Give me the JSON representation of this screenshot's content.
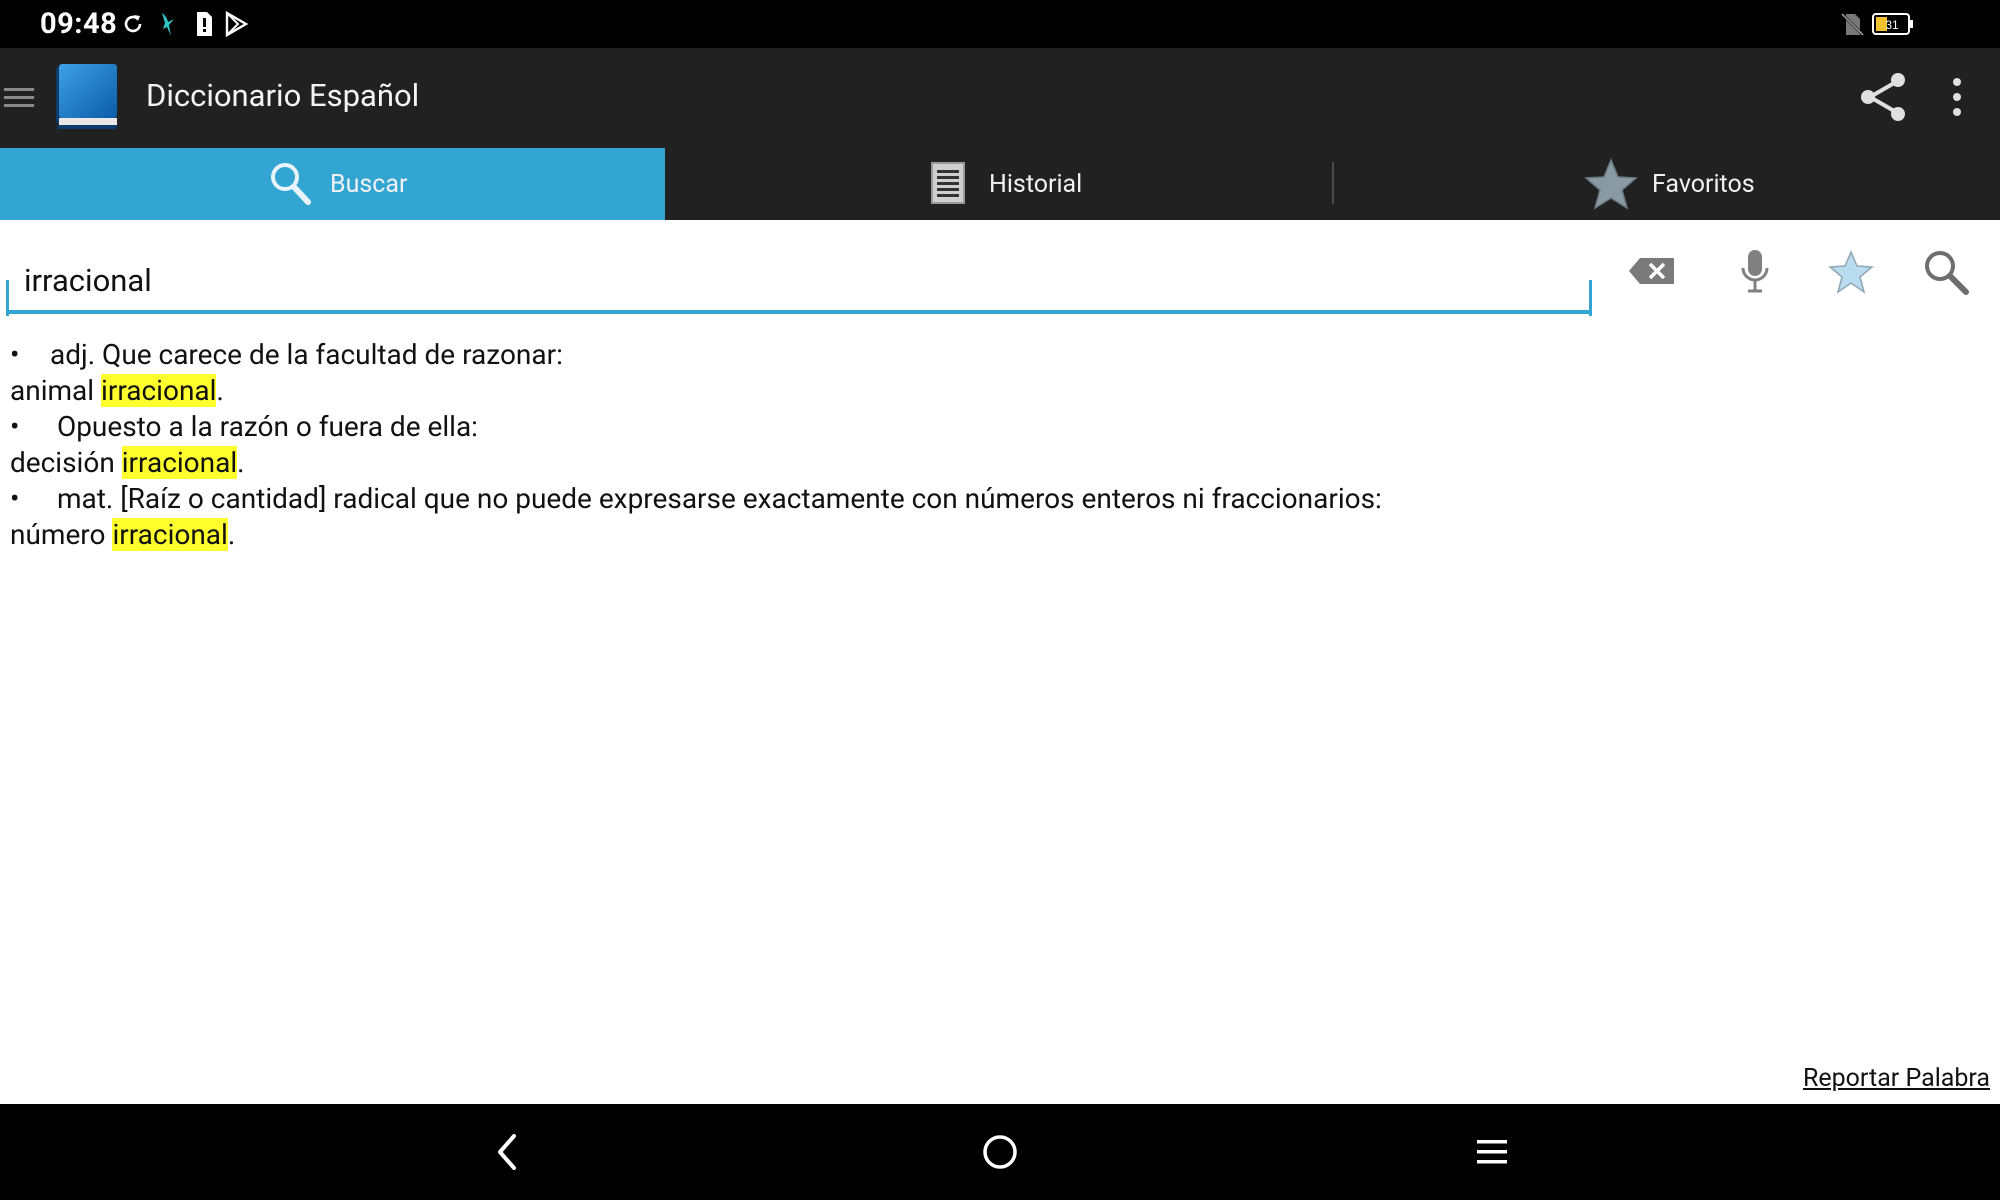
{
  "status_bar": {
    "time": "09:48",
    "icons": [
      "sync-icon",
      "bird-icon",
      "sim-alert-icon",
      "play-store-icon",
      "no-sim-icon",
      "battery-icon"
    ],
    "battery_level": "31"
  },
  "app_bar": {
    "title": "Diccionario Español",
    "icons": [
      "menu-icon",
      "app-logo",
      "share-icon",
      "more-vert-icon"
    ]
  },
  "tabs": [
    {
      "label": "Buscar",
      "icon": "search-icon",
      "active": true
    },
    {
      "label": "Historial",
      "icon": "list-icon",
      "active": false
    },
    {
      "label": "Favoritos",
      "icon": "star-icon",
      "active": false
    }
  ],
  "search": {
    "value": "irracional",
    "actions": [
      "clear-text-icon",
      "microphone-icon",
      "favorite-star-icon",
      "search-icon"
    ]
  },
  "definition": {
    "entries": [
      {
        "bullet": "•",
        "text": "adj. Que carece de la facultad de razonar:",
        "example_prefix": "animal ",
        "highlight": "irracional",
        "example_suffix": "."
      },
      {
        "bullet": "•",
        "text": " Opuesto a la razón o fuera de ella:",
        "example_prefix": "decisión ",
        "highlight": "irracional",
        "example_suffix": "."
      },
      {
        "bullet": "•",
        "text": " mat. [Raíz o cantidad] radical que no puede expresarse exactamente con números enteros ni fraccionarios:",
        "example_prefix": "número ",
        "highlight": "irracional",
        "example_suffix": "."
      }
    ]
  },
  "report_link": "Reportar Palabra",
  "nav_bar": {
    "buttons": [
      "back-icon",
      "home-icon",
      "recents-icon"
    ]
  },
  "colors": {
    "accent": "#33a5d3",
    "app_bar": "#212121",
    "highlight": "#ffff2e"
  }
}
